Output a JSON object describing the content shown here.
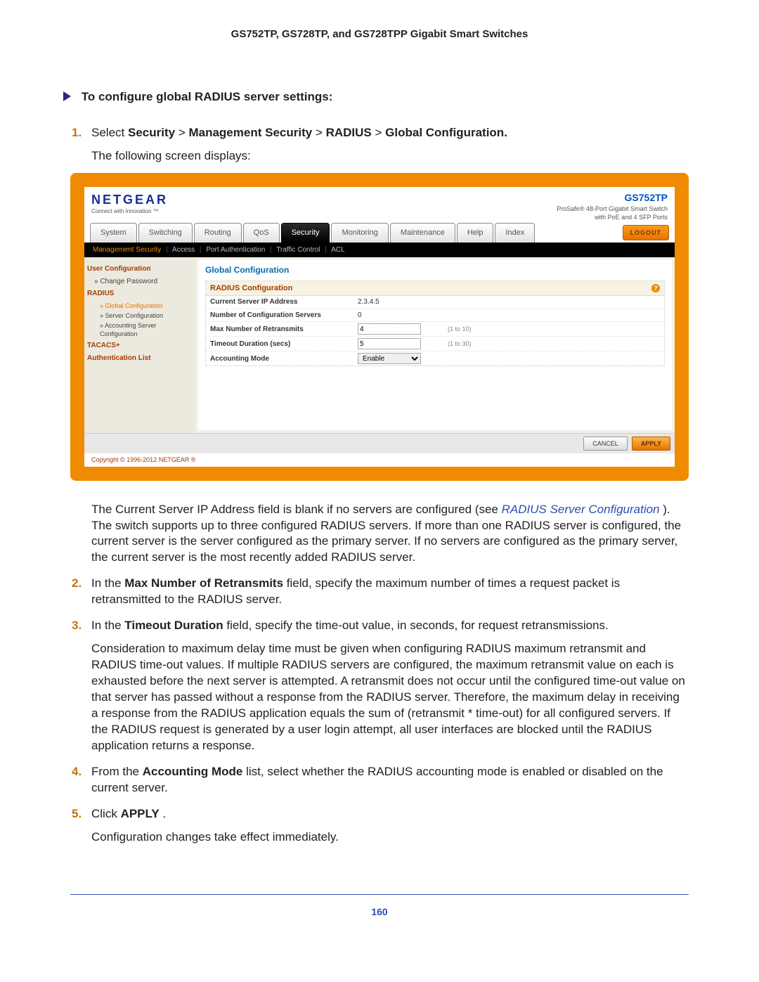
{
  "doc": {
    "running_head": "GS752TP, GS728TP, and GS728TPP Gigabit Smart Switches",
    "page_number": "160",
    "proc_heading": "To configure global RADIUS server settings:",
    "step1_a": "Select ",
    "step1_nav1": "Security",
    "step1_gt": " > ",
    "step1_nav2": "Management Security",
    "step1_nav3": "RADIUS",
    "step1_nav4": "Global Configuration.",
    "step1_b": "The following screen displays:",
    "after_shot_a": "The Current Server IP Address field is blank if no servers are configured (see ",
    "after_shot_link": "RADIUS Server Configuration ",
    "after_shot_b": "). The switch supports up to three configured RADIUS servers. If more than one RADIUS server is configured, the current server is the server configured as the primary server. If no servers are configured as the primary server, the current server is the most recently added RADIUS server.",
    "step2_a": "In the ",
    "step2_b": "Max Number of Retransmits",
    "step2_c": " field, specify the maximum number of times a request packet is retransmitted to the RADIUS server.",
    "step3_a": "In the ",
    "step3_b": "Timeout Duration",
    "step3_c": " field, specify the time-out value, in seconds, for request retransmissions.",
    "step3_para": "Consideration to maximum delay time must be given when configuring RADIUS maximum retransmit and RADIUS time-out values. If multiple RADIUS servers are configured, the maximum retransmit value on each is exhausted before the next server is attempted. A retransmit does not occur until the configured time-out value on that server has passed without a response from the RADIUS server. Therefore, the maximum delay in receiving a response from the RADIUS application equals the sum of (retransmit * time-out) for all configured servers. If the RADIUS request is generated by a user login attempt, all user interfaces are blocked until the RADIUS application returns a response.",
    "step4_a": "From the ",
    "step4_b": "Accounting Mode",
    "step4_c": " list, select whether the RADIUS accounting mode is enabled or disabled on the current server.",
    "step5_a": "Click ",
    "step5_b": "APPLY",
    "step5_c": ".",
    "step5_para": "Configuration changes take effect immediately."
  },
  "shot": {
    "brand": "NETGEAR",
    "brand_tag": "Connect with Innovation ™",
    "model": "GS752TP",
    "model_line1": "ProSafe® 48-Port Gigabit Smart Switch",
    "model_line2": "with PoE and 4 SFP Ports",
    "tabs": [
      "System",
      "Switching",
      "Routing",
      "QoS",
      "Security",
      "Monitoring",
      "Maintenance",
      "Help",
      "Index"
    ],
    "active_tab_index": 4,
    "logout": "LOGOUT",
    "subnav": [
      "Management Security",
      "Access",
      "Port Authentication",
      "Traffic Control",
      "ACL"
    ],
    "subnav_active_index": 0,
    "sidebar": {
      "user_cfg": "User Configuration",
      "change_pw": "» Change Password",
      "radius": "RADIUS",
      "global_cfg": "» Global Configuration",
      "server_cfg": "» Server Configuration",
      "acct_server": "» Accounting Server Configuration",
      "tacacs": "TACACS+",
      "auth_list": "Authentication List"
    },
    "panel": {
      "title": "Global Configuration",
      "box_title": "RADIUS Configuration",
      "rows": [
        {
          "label": "Current Server IP Address",
          "value": "2.3.4.5",
          "hint": "",
          "type": "text"
        },
        {
          "label": "Number of Configuration Servers",
          "value": "0",
          "hint": "",
          "type": "text"
        },
        {
          "label": "Max Number of Retransmits",
          "value": "4",
          "hint": "(1 to 10)",
          "type": "input"
        },
        {
          "label": "Timeout Duration (secs)",
          "value": "5",
          "hint": "(1 to 30)",
          "type": "input"
        },
        {
          "label": "Accounting Mode",
          "value": "Enable",
          "hint": "",
          "type": "select"
        }
      ],
      "help_icon": "?"
    },
    "buttons": {
      "cancel": "CANCEL",
      "apply": "APPLY"
    },
    "copyright": "Copyright © 1996-2012 NETGEAR ®"
  }
}
